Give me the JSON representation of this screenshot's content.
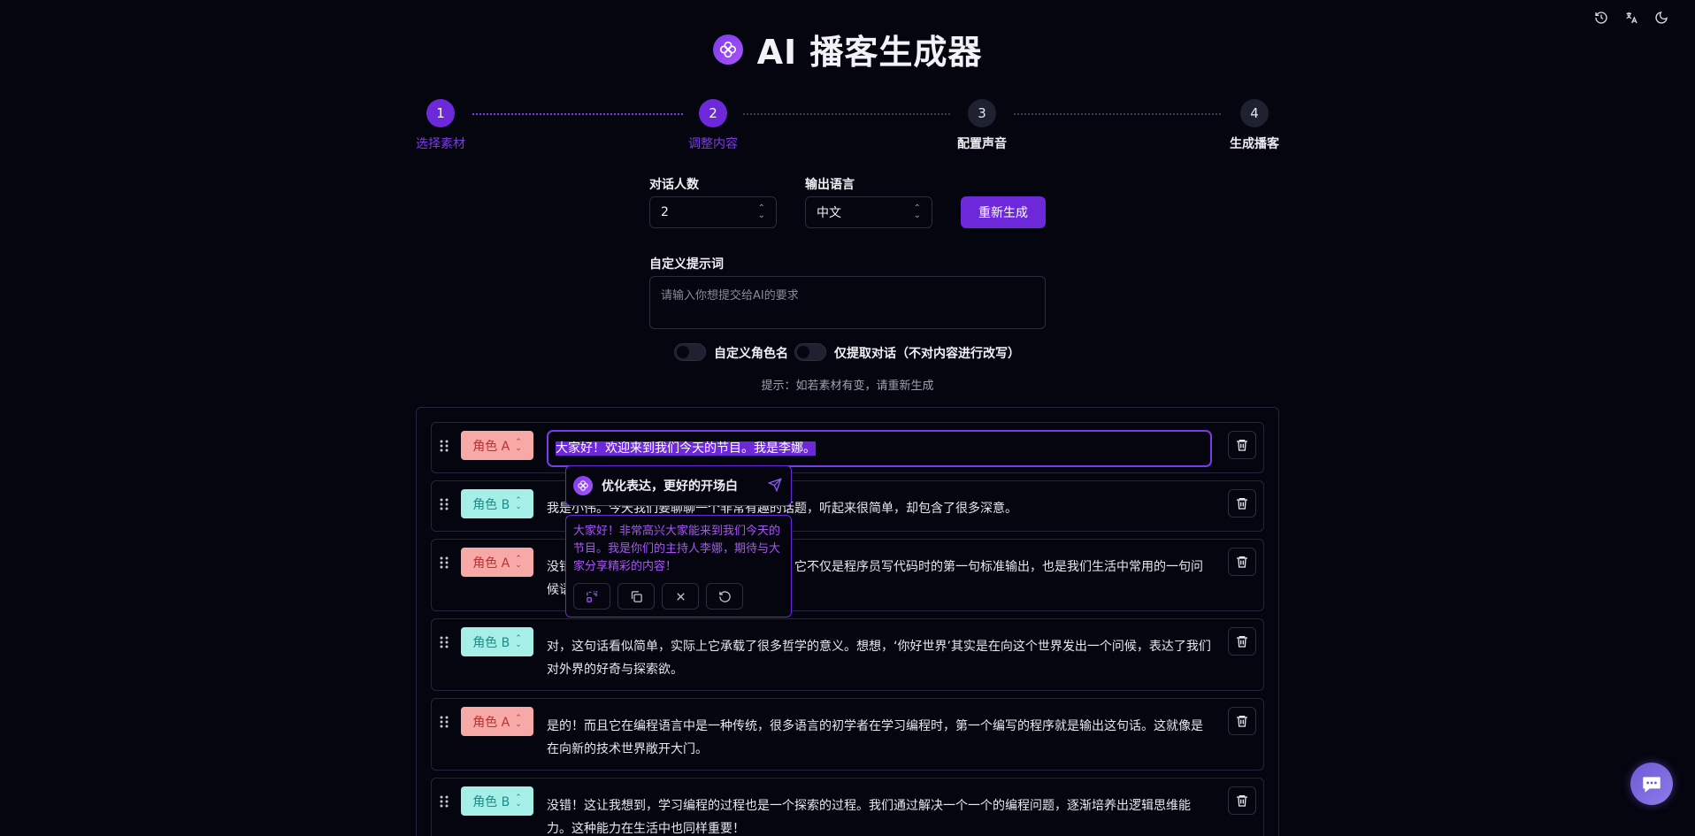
{
  "app": {
    "title": "AI 播客生成器",
    "logo_icon": "flower-icon",
    "accent_color": "#6d28d9"
  },
  "tools": [
    {
      "name": "history-icon"
    },
    {
      "name": "translate-icon"
    },
    {
      "name": "theme-moon-icon"
    }
  ],
  "stepper": {
    "steps": [
      {
        "num": "1",
        "label": "选择素材",
        "state": "done"
      },
      {
        "num": "2",
        "label": "调整内容",
        "state": "current"
      },
      {
        "num": "3",
        "label": "配置声音",
        "state": "todo"
      },
      {
        "num": "4",
        "label": "生成播客",
        "state": "todo"
      }
    ]
  },
  "form": {
    "speakers_label": "对话人数",
    "speakers_value": "2",
    "language_label": "输出语言",
    "language_value": "中文",
    "regenerate_label": "重新生成",
    "prompt_label": "自定义提示词",
    "prompt_placeholder": "请输入你想提交给AI的要求",
    "toggle_custom_roles": "自定义角色名",
    "toggle_dialog_only": "仅提取对话（不对内容进行改写）",
    "hint": "提示：如若素材有变，请重新生成"
  },
  "dialog": [
    {
      "role": "角色 A",
      "type": "a",
      "text": "大家好！欢迎来到我们今天的节目。我是李娜。"
    },
    {
      "role": "角色 B",
      "type": "b",
      "text": "我是小伟。今天我们要聊聊一个非常有趣的话题，听起来很简单，却包含了很多深意。"
    },
    {
      "role": "角色 A",
      "type": "a",
      "text": "没错，就是你好世界。我们最熟悉的这句话，它不仅是程序员写代码时的第一句标准输出，也是我们生活中常用的一句问候语。"
    },
    {
      "role": "角色 B",
      "type": "b",
      "text": "对，这句话看似简单，实际上它承载了很多哲学的意义。想想，‘你好世界’其实是在向这个世界发出一个问候，表达了我们对外界的好奇与探索欲。"
    },
    {
      "role": "角色 A",
      "type": "a",
      "text": "是的！而且它在编程语言中是一种传统，很多语言的初学者在学习编程时，第一个编写的程序就是输出这句话。这就像是在向新的技术世界敞开大门。"
    },
    {
      "role": "角色 B",
      "type": "b",
      "text": "没错！这让我想到，学习编程的过程也是一个探索的过程。我们通过解决一个一个的编程问题，逐渐培养出逻辑思维能力。这种能力在生活中也同样重要！"
    }
  ],
  "ai_popover": {
    "instruction": "优化表达，更好的开场白",
    "suggestion": "大家好！非常高兴大家能来到我们今天的节目。我是你们的主持人李娜，期待与大家分享精彩的内容！",
    "actions": [
      {
        "name": "replace-icon"
      },
      {
        "name": "copy-icon"
      },
      {
        "name": "close-icon"
      },
      {
        "name": "retry-icon"
      }
    ]
  },
  "chat_fab_icon": "chat-bubble-icon"
}
